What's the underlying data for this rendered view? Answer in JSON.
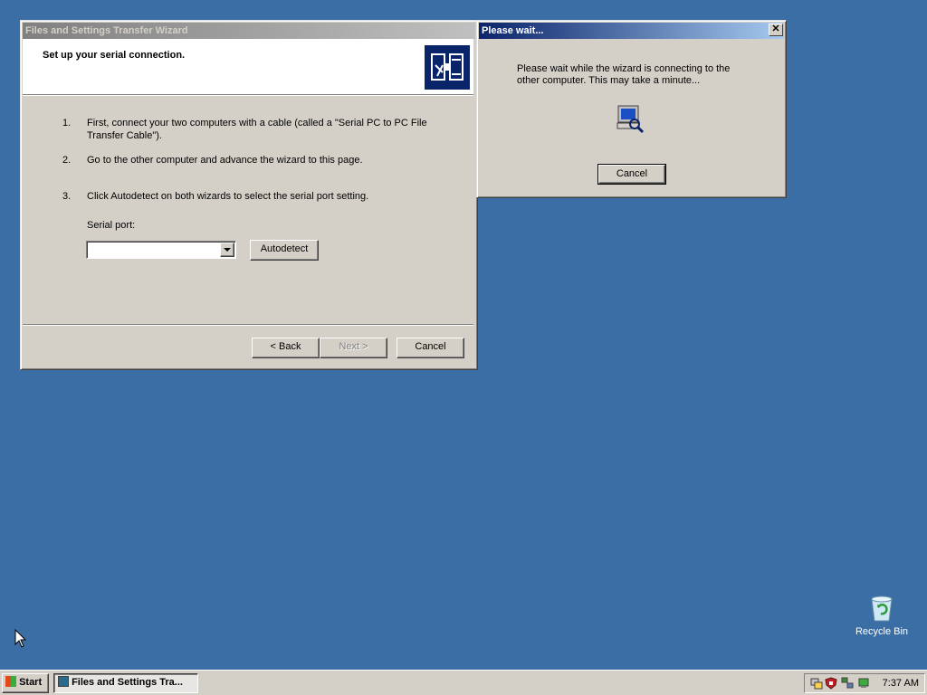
{
  "wizard": {
    "title": "Files and Settings Transfer Wizard",
    "header": "Set up your serial connection.",
    "steps": [
      {
        "num": "1.",
        "text": "First, connect your two computers with a cable (called a \"Serial PC to PC File",
        "text2": "Transfer Cable\")."
      },
      {
        "num": "2.",
        "text": "Go to the other computer and advance the wizard to this page."
      },
      {
        "num": "3.",
        "text": "Click Autodetect on both wizards to select the serial port setting."
      }
    ],
    "serial_port_label": "Serial port:",
    "serial_port_value": "",
    "autodetect_label": "Autodetect",
    "back_label": "< Back",
    "next_label": "Next >",
    "cancel_label": "Cancel"
  },
  "wait_dialog": {
    "title": "Please wait...",
    "message_line1": "Please wait while the wizard is connecting to the",
    "message_line2": "other computer. This may take a minute...",
    "cancel_label": "Cancel",
    "close_glyph": "✕"
  },
  "desktop": {
    "recycle_bin_label": "Recycle Bin"
  },
  "taskbar": {
    "start_label": "Start",
    "task_label": "Files and Settings Tra...",
    "clock": "7:37 AM"
  },
  "colors": {
    "desktop": "#3a6ea5",
    "title_active": "#0a246a",
    "title_inactive": "#808080",
    "wizard_icon_bg": "#0a246a"
  }
}
